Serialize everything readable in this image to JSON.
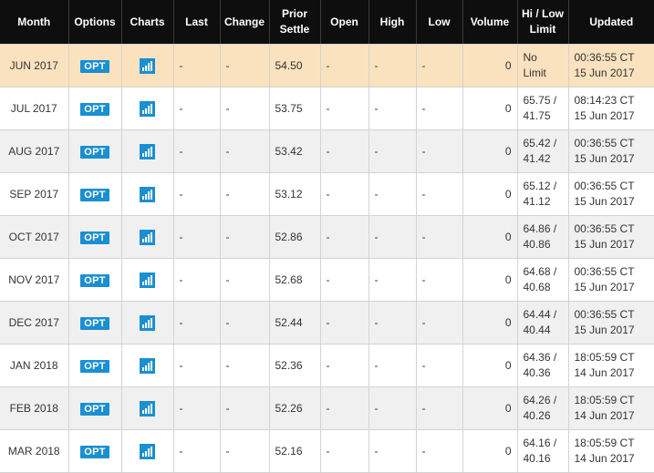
{
  "columns": [
    "Month",
    "Options",
    "Charts",
    "Last",
    "Change",
    "Prior\nSettle",
    "Open",
    "High",
    "Low",
    "Volume",
    "Hi / Low\nLimit",
    "Updated"
  ],
  "opt_label": "OPT",
  "colors": {
    "header_bg": "#0e0e0e",
    "front_month_bg": "#fbe2bf",
    "alt_row_bg": "#f0f0f0",
    "button_blue": "#1a8fd1"
  },
  "rows": [
    {
      "month": "JUN 2017",
      "last": "-",
      "change": "-",
      "prior_settle": "54.50",
      "open": "-",
      "high": "-",
      "low": "-",
      "volume": "0",
      "limit": "No Limit",
      "updated_time": "00:36:55 CT",
      "updated_date": "15 Jun 2017"
    },
    {
      "month": "JUL 2017",
      "last": "-",
      "change": "-",
      "prior_settle": "53.75",
      "open": "-",
      "high": "-",
      "low": "-",
      "volume": "0",
      "limit": "65.75 /\n41.75",
      "updated_time": "08:14:23 CT",
      "updated_date": "15 Jun 2017"
    },
    {
      "month": "AUG 2017",
      "last": "-",
      "change": "-",
      "prior_settle": "53.42",
      "open": "-",
      "high": "-",
      "low": "-",
      "volume": "0",
      "limit": "65.42 /\n41.42",
      "updated_time": "00:36:55 CT",
      "updated_date": "15 Jun 2017"
    },
    {
      "month": "SEP 2017",
      "last": "-",
      "change": "-",
      "prior_settle": "53.12",
      "open": "-",
      "high": "-",
      "low": "-",
      "volume": "0",
      "limit": "65.12 /\n41.12",
      "updated_time": "00:36:55 CT",
      "updated_date": "15 Jun 2017"
    },
    {
      "month": "OCT 2017",
      "last": "-",
      "change": "-",
      "prior_settle": "52.86",
      "open": "-",
      "high": "-",
      "low": "-",
      "volume": "0",
      "limit": "64.86 /\n40.86",
      "updated_time": "00:36:55 CT",
      "updated_date": "15 Jun 2017"
    },
    {
      "month": "NOV 2017",
      "last": "-",
      "change": "-",
      "prior_settle": "52.68",
      "open": "-",
      "high": "-",
      "low": "-",
      "volume": "0",
      "limit": "64.68 /\n40.68",
      "updated_time": "00:36:55 CT",
      "updated_date": "15 Jun 2017"
    },
    {
      "month": "DEC 2017",
      "last": "-",
      "change": "-",
      "prior_settle": "52.44",
      "open": "-",
      "high": "-",
      "low": "-",
      "volume": "0",
      "limit": "64.44 /\n40.44",
      "updated_time": "00:36:55 CT",
      "updated_date": "15 Jun 2017"
    },
    {
      "month": "JAN 2018",
      "last": "-",
      "change": "-",
      "prior_settle": "52.36",
      "open": "-",
      "high": "-",
      "low": "-",
      "volume": "0",
      "limit": "64.36 /\n40.36",
      "updated_time": "18:05:59 CT",
      "updated_date": "14 Jun 2017"
    },
    {
      "month": "FEB 2018",
      "last": "-",
      "change": "-",
      "prior_settle": "52.26",
      "open": "-",
      "high": "-",
      "low": "-",
      "volume": "0",
      "limit": "64.26 /\n40.26",
      "updated_time": "18:05:59 CT",
      "updated_date": "14 Jun 2017"
    },
    {
      "month": "MAR 2018",
      "last": "-",
      "change": "-",
      "prior_settle": "52.16",
      "open": "-",
      "high": "-",
      "low": "-",
      "volume": "0",
      "limit": "64.16 /\n40.16",
      "updated_time": "18:05:59 CT",
      "updated_date": "14 Jun 2017"
    }
  ]
}
